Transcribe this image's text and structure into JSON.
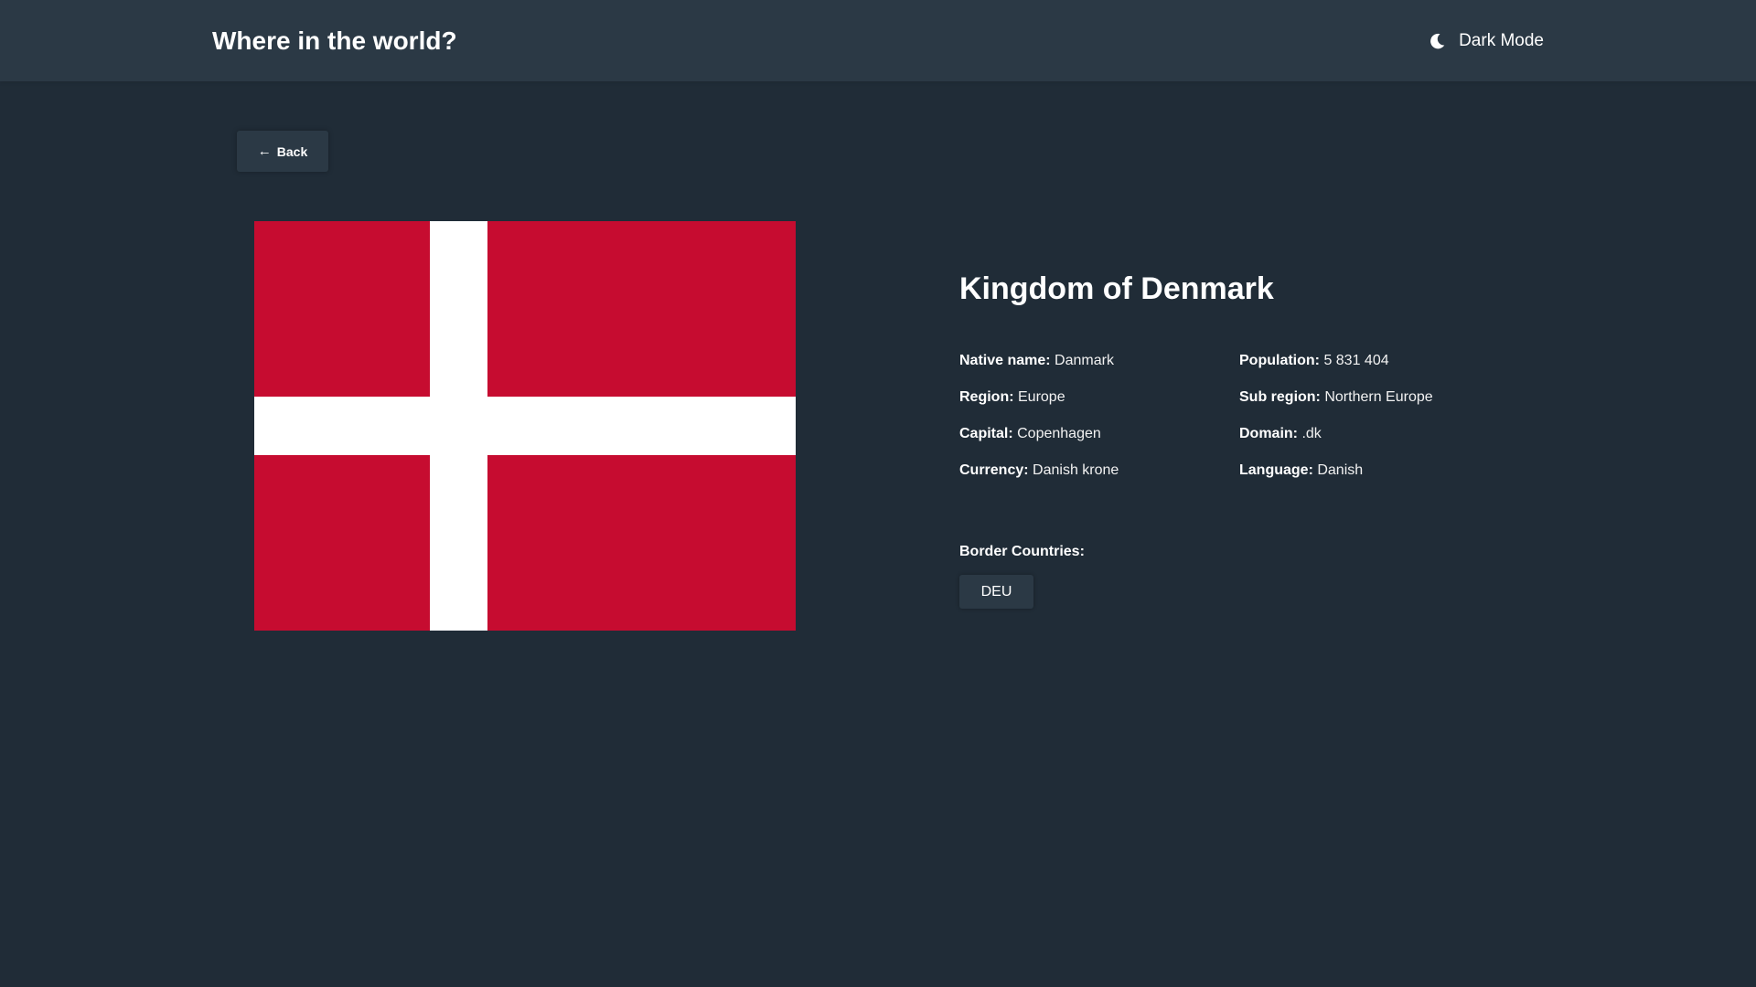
{
  "header": {
    "title": "Where in the world?",
    "theme_toggle": {
      "icon": "moon-icon",
      "label": "Dark Mode"
    }
  },
  "back_button": {
    "icon": "arrow-left-icon",
    "arrow": "←",
    "label": "Back"
  },
  "flag": {
    "description_icon": "denmark-flag",
    "colors": {
      "red": "#c60c30",
      "white": "#ffffff"
    }
  },
  "country": {
    "name": "Kingdom of Denmark",
    "details_left": [
      {
        "label": "Native name:",
        "value": "Danmark"
      },
      {
        "label": "Region:",
        "value": "Europe"
      },
      {
        "label": "Capital:",
        "value": "Copenhagen"
      },
      {
        "label": "Currency:",
        "value": "Danish krone"
      }
    ],
    "details_right": [
      {
        "label": "Population:",
        "value": "5 831 404"
      },
      {
        "label": "Sub region:",
        "value": "Northern Europe"
      },
      {
        "label": "Domain:",
        "value": ".dk"
      },
      {
        "label": "Language:",
        "value": "Danish"
      }
    ],
    "border_label": "Border Countries:",
    "border_countries": [
      "DEU"
    ]
  },
  "colors": {
    "background": "#202c37",
    "elements": "#2b3945",
    "text": "#ffffff"
  }
}
